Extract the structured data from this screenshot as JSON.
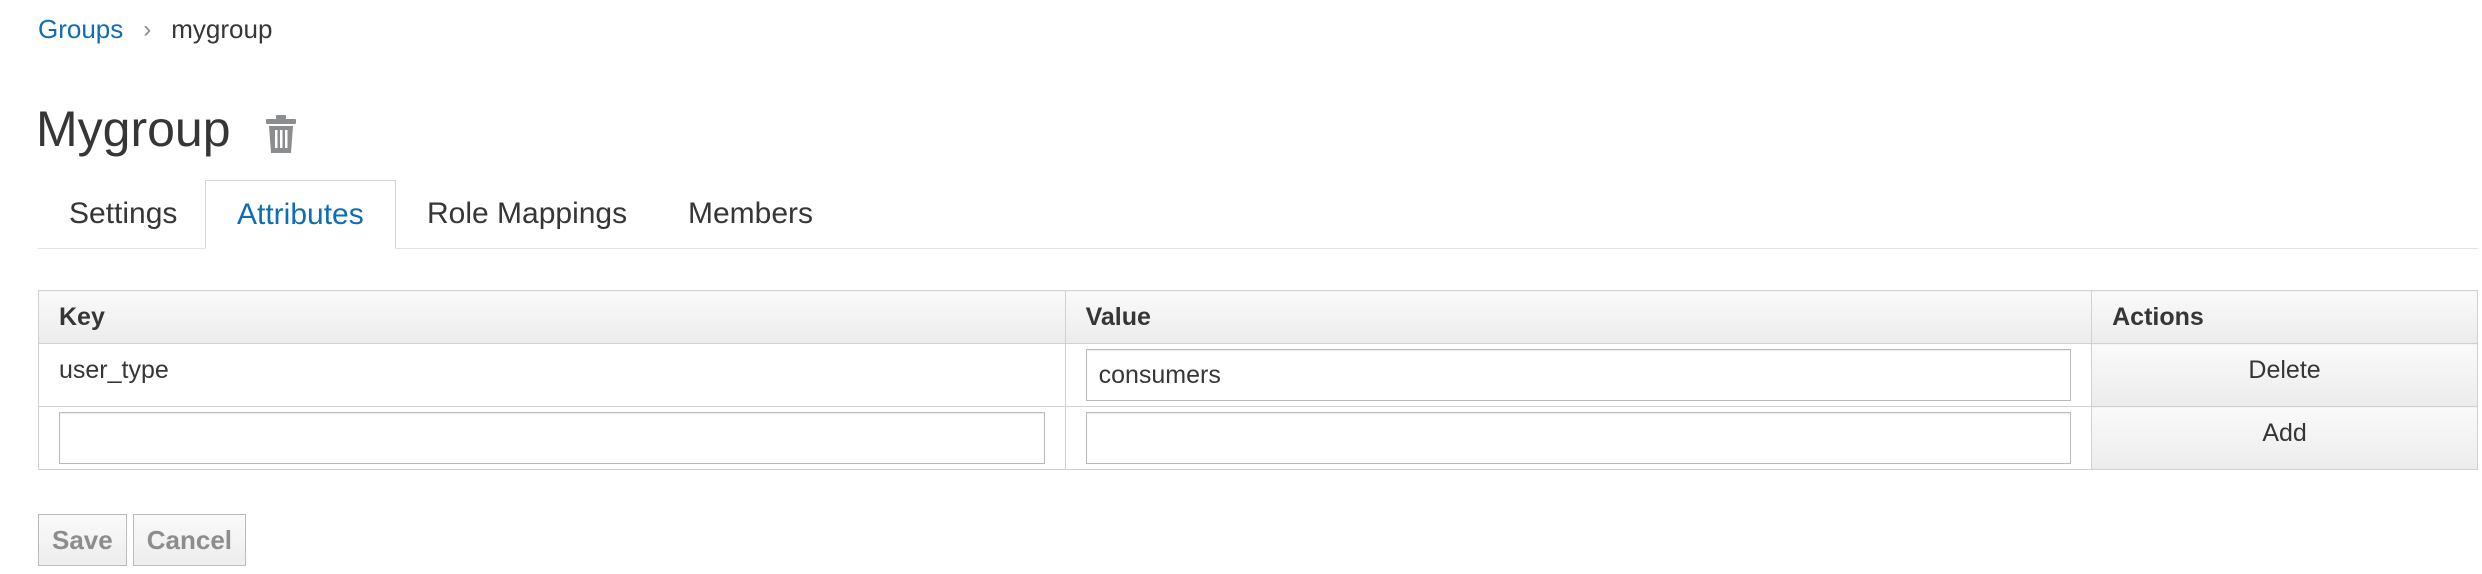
{
  "breadcrumb": {
    "parent": "Groups",
    "separator": "›",
    "current": "mygroup"
  },
  "page": {
    "title": "Mygroup",
    "delete_icon": "trash-icon"
  },
  "tabs": [
    {
      "label": "Settings",
      "active": false
    },
    {
      "label": "Attributes",
      "active": true
    },
    {
      "label": "Role Mappings",
      "active": false
    },
    {
      "label": "Members",
      "active": false
    }
  ],
  "table": {
    "headers": {
      "key": "Key",
      "value": "Value",
      "actions": "Actions"
    },
    "rows": [
      {
        "key": "user_type",
        "value": "consumers",
        "action": "Delete"
      }
    ],
    "new_row": {
      "key": "",
      "value": "",
      "action": "Add"
    }
  },
  "buttons": {
    "save": "Save",
    "cancel": "Cancel"
  },
  "colors": {
    "link": "#0f6db3",
    "text": "#363636",
    "muted": "#8b8d8f"
  }
}
